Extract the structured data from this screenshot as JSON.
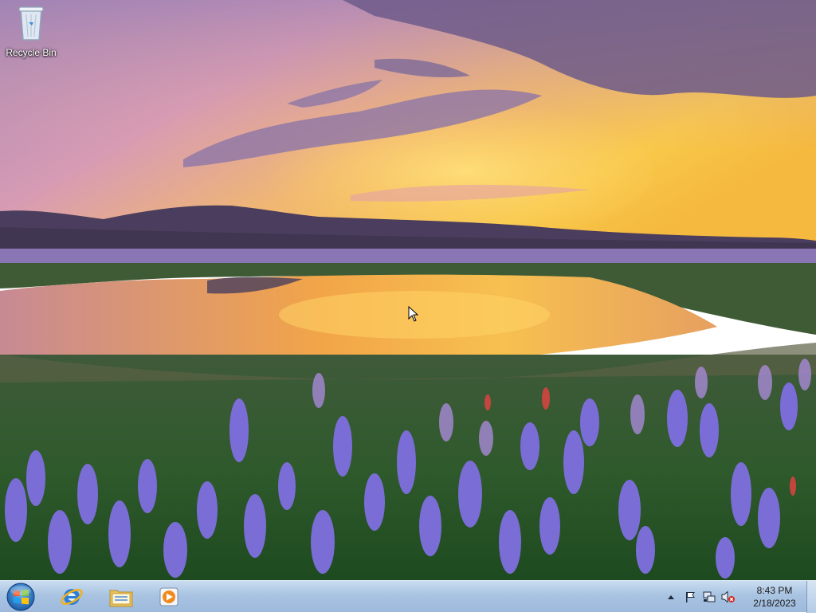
{
  "desktop": {
    "icons": [
      {
        "label": "Recycle Bin",
        "icon": "recycle-bin-icon"
      }
    ]
  },
  "taskbar": {
    "start_icon": "windows-start-orb-icon",
    "pinned": [
      {
        "icon": "internet-explorer-icon"
      },
      {
        "icon": "file-explorer-icon"
      },
      {
        "icon": "media-player-icon"
      }
    ],
    "tray": {
      "icons": [
        "show-hidden-icons-arrow",
        "action-center-flag-icon",
        "network-icon",
        "volume-muted-icon"
      ],
      "time": "8:43 PM",
      "date": "2/18/2023"
    }
  },
  "colors": {
    "taskbar_top": "#c9dcf0",
    "taskbar_bottom": "#9db9dc",
    "sky_purple": "#b58ab0",
    "sunset_gold": "#f5c040",
    "flowers": "#7b6fd9"
  }
}
